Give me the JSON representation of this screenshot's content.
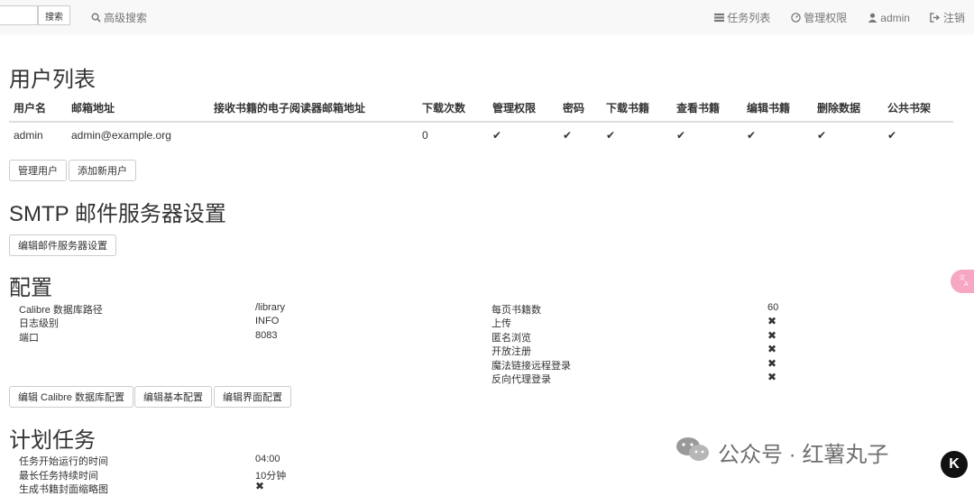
{
  "topbar": {
    "search_button": "搜索",
    "advanced_search": "高级搜索",
    "nav": [
      {
        "label": "任务列表"
      },
      {
        "label": "管理权限"
      },
      {
        "label": "admin"
      },
      {
        "label": "注销"
      }
    ]
  },
  "users_section": {
    "title": "用户列表",
    "columns": [
      "用户名",
      "邮箱地址",
      "接收书籍的电子阅读器邮箱地址",
      "下载次数",
      "管理权限",
      "密码",
      "下载书籍",
      "查看书籍",
      "编辑书籍",
      "删除数据",
      "公共书架"
    ],
    "rows": [
      {
        "username": "admin",
        "email": "admin@example.org",
        "ereader_email": "",
        "downloads": "0",
        "admin": "✔",
        "password": "✔",
        "download": "✔",
        "view": "✔",
        "edit": "✔",
        "delete": "✔",
        "shelf": "✔"
      }
    ],
    "buttons": {
      "manage": "管理用户",
      "add": "添加新用户"
    }
  },
  "smtp_section": {
    "title": "SMTP 邮件服务器设置",
    "edit_button": "编辑邮件服务器设置"
  },
  "config_section": {
    "title": "配置",
    "left": [
      {
        "label": "Calibre 数据库路径",
        "value": "/library"
      },
      {
        "label": "日志级别",
        "value": "INFO"
      },
      {
        "label": "端口",
        "value": "8083"
      }
    ],
    "right": [
      {
        "label": "每页书籍数",
        "value": "60"
      },
      {
        "label": "上传",
        "value": "✖"
      },
      {
        "label": "匿名浏览",
        "value": "✖"
      },
      {
        "label": "开放注册",
        "value": "✖"
      },
      {
        "label": "魔法链接远程登录",
        "value": "✖"
      },
      {
        "label": "反向代理登录",
        "value": "✖"
      }
    ],
    "buttons": {
      "db": "编辑 Calibre 数据库配置",
      "basic": "编辑基本配置",
      "ui": "编辑界面配置"
    }
  },
  "tasks_section": {
    "title": "计划任务",
    "rows": [
      {
        "label": "任务开始运行的时间",
        "value": "04:00"
      },
      {
        "label": "最长任务持续时间",
        "value": "10分钟"
      },
      {
        "label": "生成书籍封面缩略图",
        "value": "✖"
      }
    ]
  },
  "watermark": {
    "text": "公众号 · 红薯丸子",
    "logo": "K"
  }
}
